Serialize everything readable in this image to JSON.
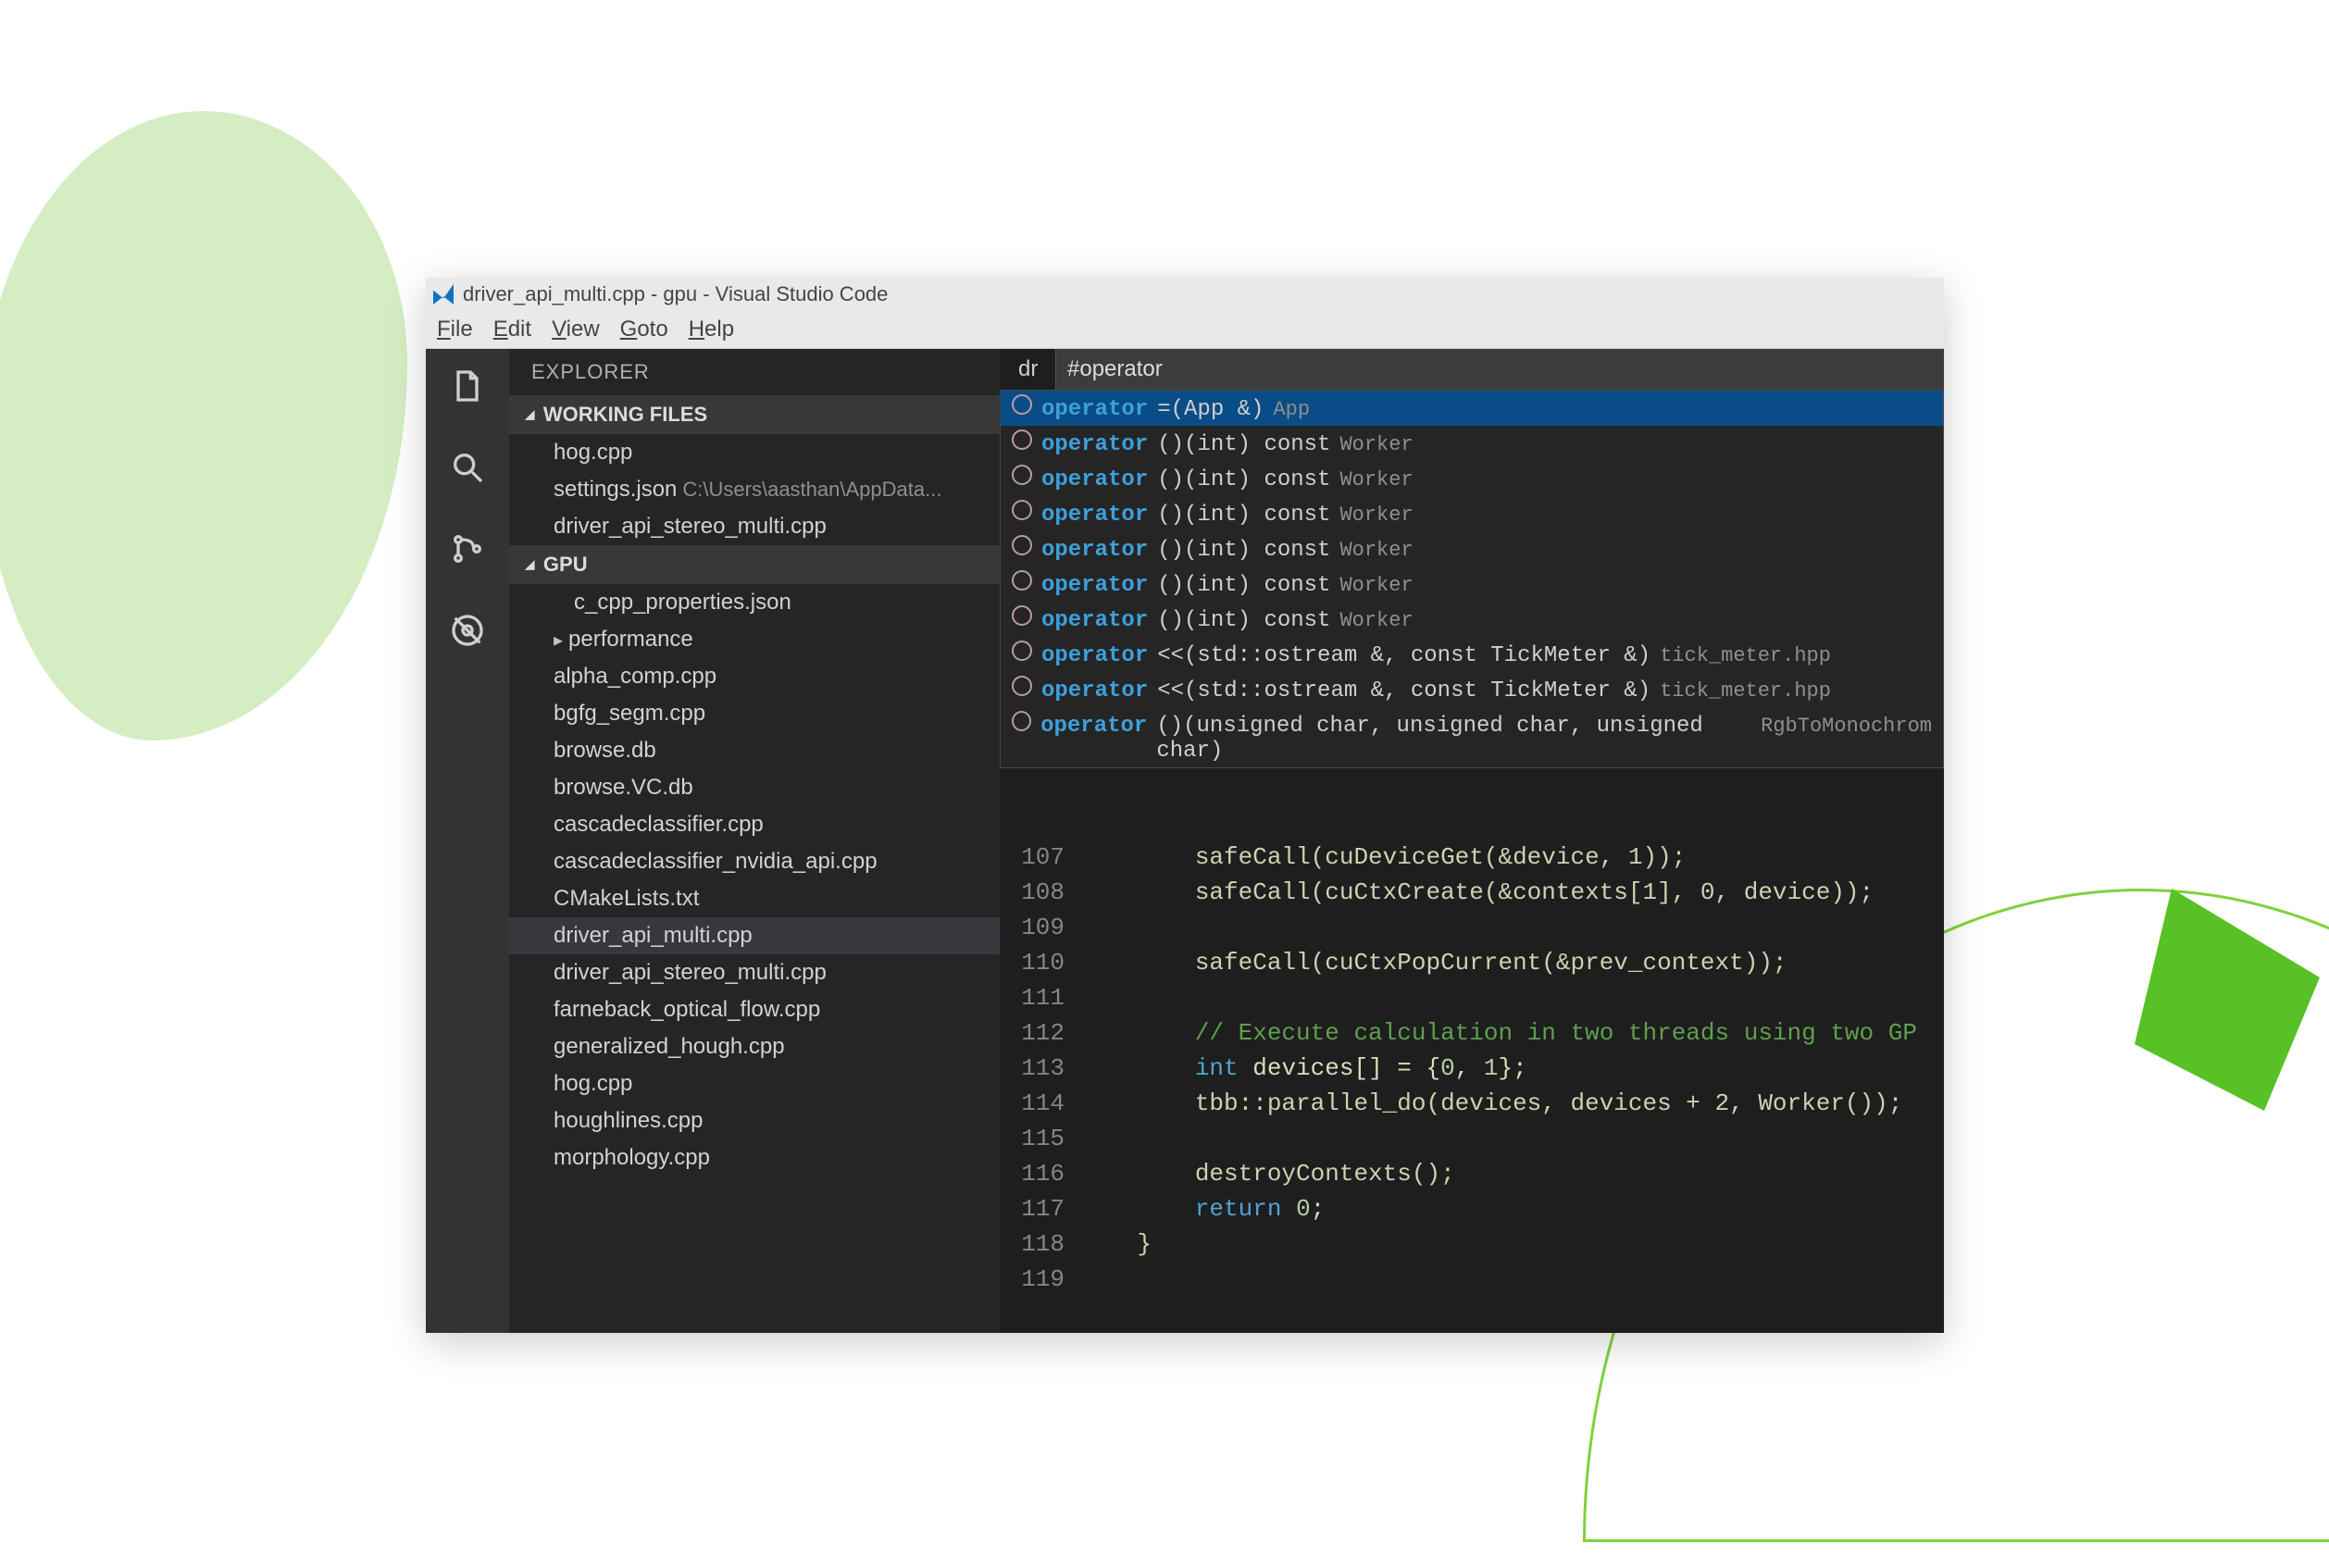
{
  "window_title": "driver_api_multi.cpp - gpu - Visual Studio Code",
  "menu": [
    "File",
    "Edit",
    "View",
    "Goto",
    "Help"
  ],
  "activity": [
    "files",
    "search",
    "git",
    "debug"
  ],
  "explorer": {
    "title": "EXPLORER",
    "working_files_header": "WORKING FILES",
    "working_files": [
      {
        "name": "hog.cpp"
      },
      {
        "name": "settings.json",
        "hint": "C:\\Users\\aasthan\\AppData..."
      },
      {
        "name": "driver_api_stereo_multi.cpp"
      }
    ],
    "folder_header": "GPU",
    "tree": [
      {
        "name": "c_cpp_properties.json",
        "indent": true
      },
      {
        "name": "performance",
        "folder": true
      },
      {
        "name": "alpha_comp.cpp"
      },
      {
        "name": "bgfg_segm.cpp"
      },
      {
        "name": "browse.db"
      },
      {
        "name": "browse.VC.db"
      },
      {
        "name": "cascadeclassifier.cpp"
      },
      {
        "name": "cascadeclassifier_nvidia_api.cpp"
      },
      {
        "name": "CMakeLists.txt"
      },
      {
        "name": "driver_api_multi.cpp",
        "active": true
      },
      {
        "name": "driver_api_stereo_multi.cpp"
      },
      {
        "name": "farneback_optical_flow.cpp"
      },
      {
        "name": "generalized_hough.cpp"
      },
      {
        "name": "hog.cpp"
      },
      {
        "name": "houghlines.cpp"
      },
      {
        "name": "morphology.cpp"
      }
    ]
  },
  "tab_label": "dr",
  "search_query": "#operator",
  "suggestions": [
    {
      "name": "operator",
      "sig": "=(App &)",
      "src": "App",
      "sel": true
    },
    {
      "name": "operator",
      "sig": "()(int) const",
      "src": "Worker"
    },
    {
      "name": "operator",
      "sig": "()(int) const",
      "src": "Worker"
    },
    {
      "name": "operator",
      "sig": "()(int) const",
      "src": "Worker"
    },
    {
      "name": "operator",
      "sig": "()(int) const",
      "src": "Worker"
    },
    {
      "name": "operator",
      "sig": "()(int) const",
      "src": "Worker"
    },
    {
      "name": "operator",
      "sig": "()(int) const",
      "src": "Worker"
    },
    {
      "name": "operator",
      "sig": "<<(std::ostream &, const TickMeter &)",
      "src": "tick_meter.hpp"
    },
    {
      "name": "operator",
      "sig": "<<(std::ostream &, const TickMeter &)",
      "src": "tick_meter.hpp"
    },
    {
      "name": "operator",
      "sig": "()(unsigned char, unsigned char, unsigned char)",
      "src": "RgbToMonochrom"
    }
  ],
  "code": {
    "start": 107,
    "lines": [
      {
        "n": 107,
        "t": "        safeCall(cuDeviceGet(&device, 1));"
      },
      {
        "n": 108,
        "t": "        safeCall(cuCtxCreate(&contexts[1], 0, device));"
      },
      {
        "n": 109,
        "t": ""
      },
      {
        "n": 110,
        "t": "        safeCall(cuCtxPopCurrent(&prev_context));"
      },
      {
        "n": 111,
        "t": ""
      },
      {
        "n": 112,
        "t": "        // Execute calculation in two threads using two GP",
        "comment": true
      },
      {
        "n": 113,
        "t": "        int devices[] = {0, 1};",
        "decl": true
      },
      {
        "n": 114,
        "t": "        tbb::parallel_do(devices, devices + 2, Worker());"
      },
      {
        "n": 115,
        "t": ""
      },
      {
        "n": 116,
        "t": "        destroyContexts();"
      },
      {
        "n": 117,
        "t": "        return 0;",
        "ret": true
      },
      {
        "n": 118,
        "t": "    }"
      },
      {
        "n": 119,
        "t": ""
      }
    ]
  }
}
